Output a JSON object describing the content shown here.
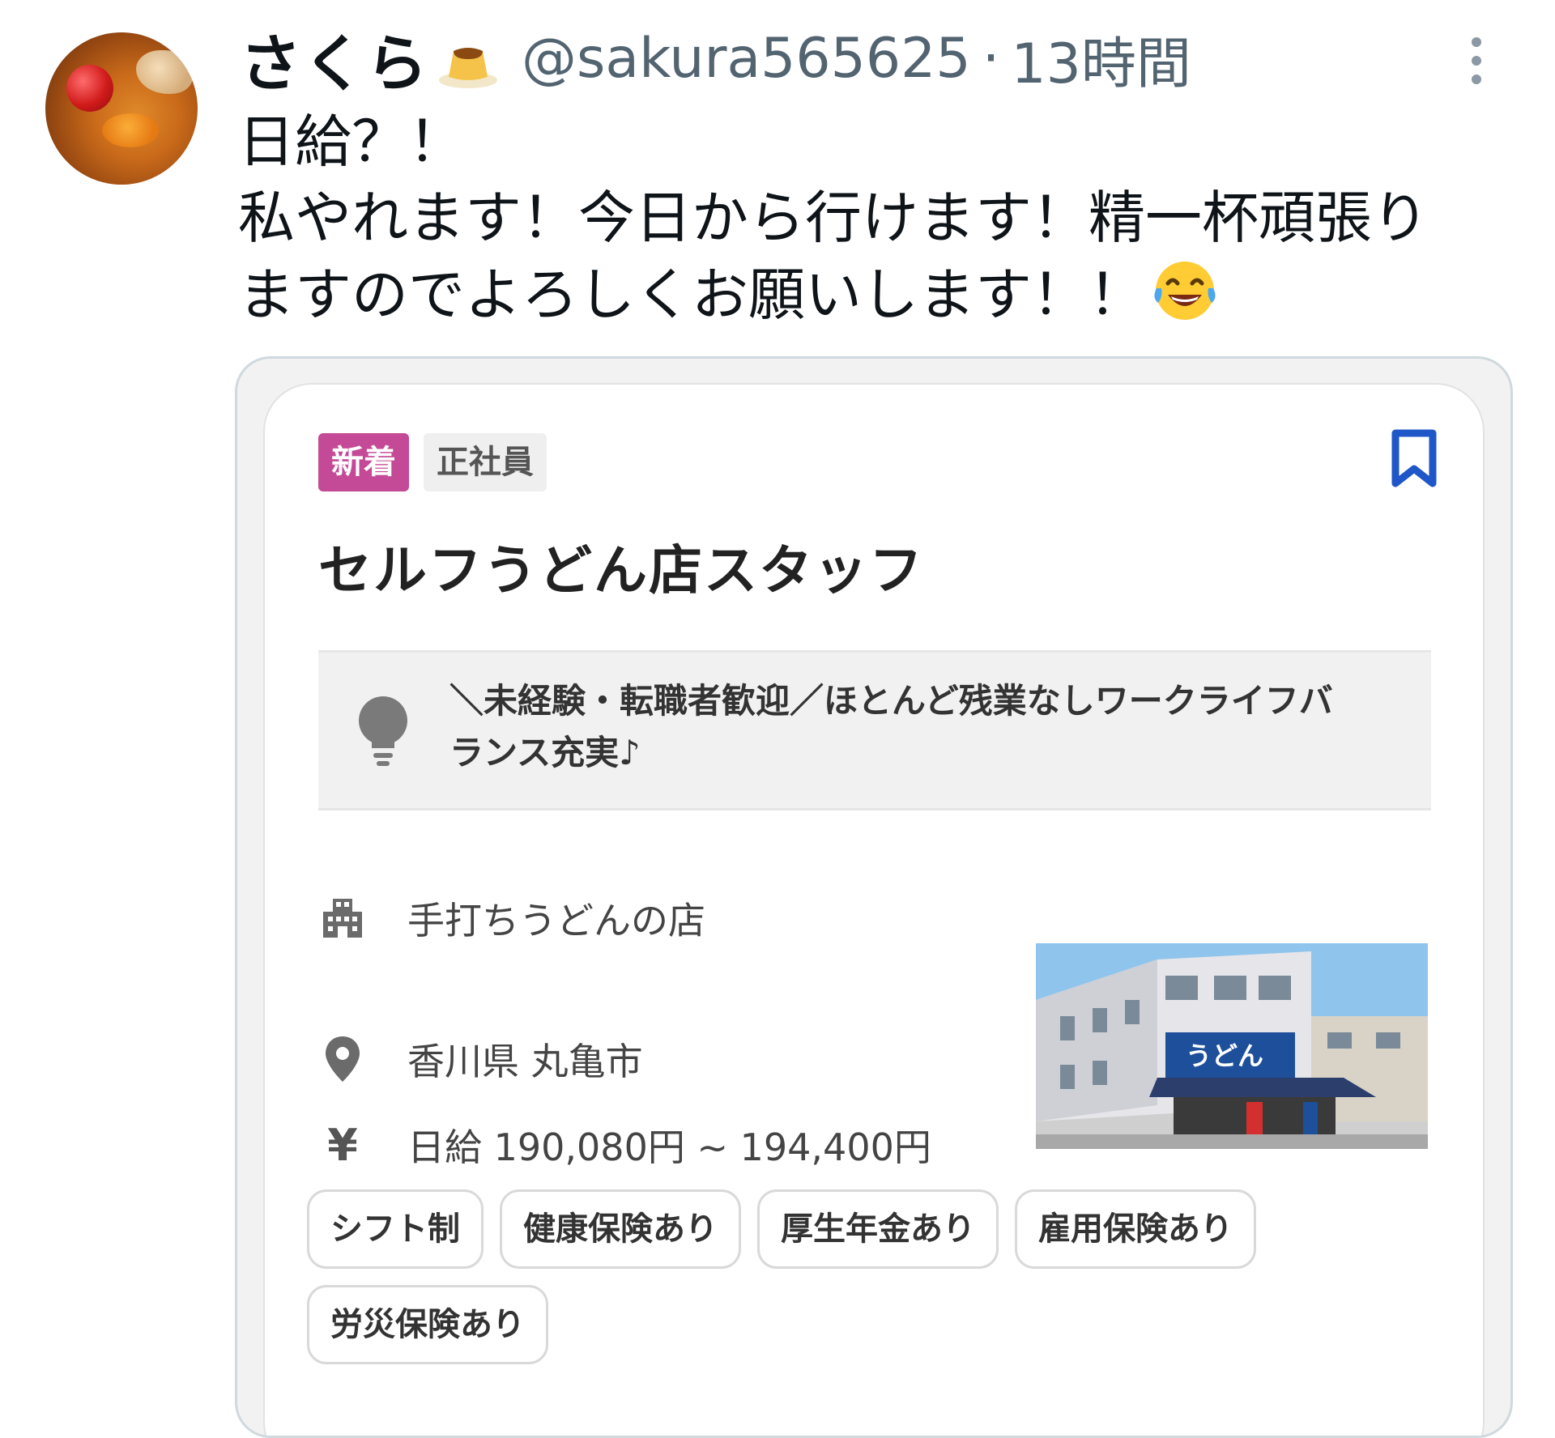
{
  "tweet": {
    "display_name": "さくら",
    "handle": "@sakura565625",
    "separator": "·",
    "time": "13時間",
    "text_lines": [
      "日給？！",
      "私やれます！今日から行けます！精一杯頑張り",
      "ますのでよろしくお願いします！！"
    ],
    "emoji_name": "face-with-tears-of-joy-emoji"
  },
  "job_card": {
    "badge_new": "新着",
    "badge_type": "正社員",
    "title": "セルフうどん店スタッフ",
    "highlight_line1": "＼未経験・転職者歓迎／ほとんど残業なしワークライフバ",
    "highlight_line2": "ランス充実♪",
    "company": "手打ちうどんの店",
    "location": "香川県 丸亀市",
    "salary": "日給 190,080円 ~ 194,400円",
    "yen_symbol": "¥",
    "photo_sign": "うどん",
    "tags": [
      "シフト制",
      "健康保険あり",
      "厚生年金あり",
      "雇用保険あり",
      "労災保険あり"
    ]
  },
  "colors": {
    "badge_new": "#c44996",
    "bookmark": "#1f56c8",
    "muted": "#536471"
  }
}
